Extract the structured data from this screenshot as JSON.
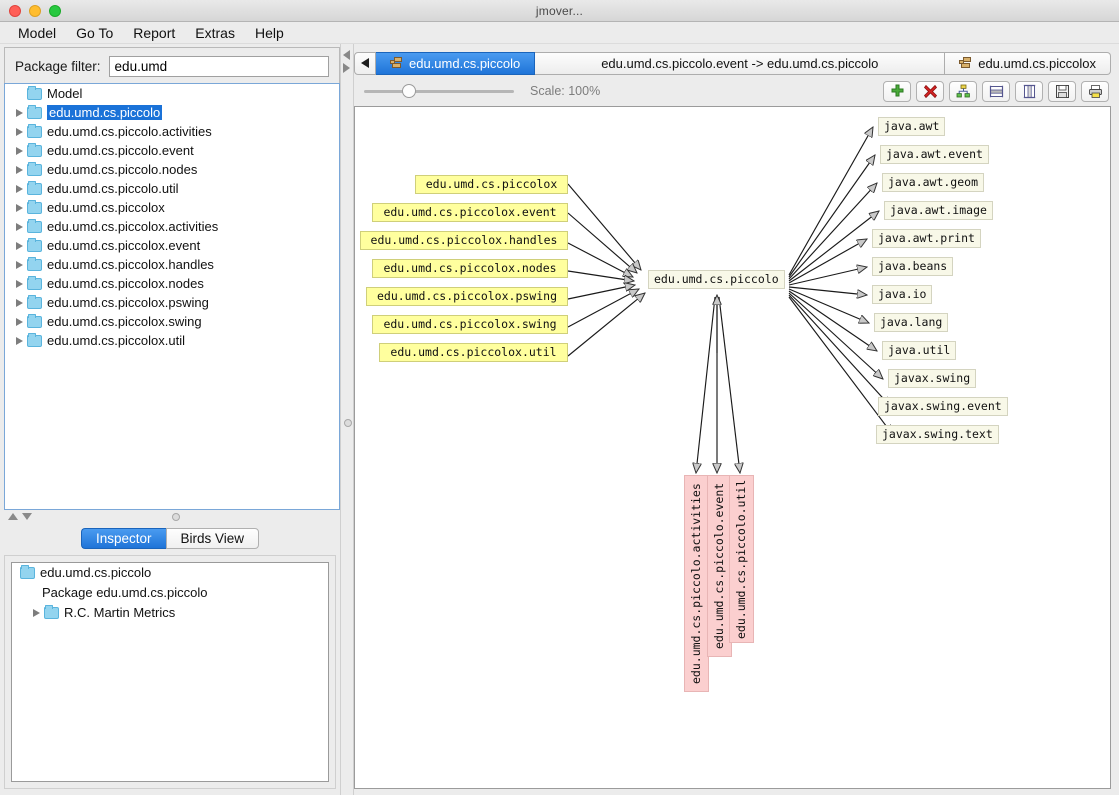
{
  "window": {
    "title": "jmover...",
    "traffic_lights": [
      "close-red",
      "minimize-yellow",
      "zoom-green"
    ]
  },
  "menubar": {
    "items": [
      "Model",
      "Go To",
      "Report",
      "Extras",
      "Help"
    ]
  },
  "left_panel": {
    "filter": {
      "label": "Package filter:",
      "value": "edu.umd"
    },
    "tree": {
      "root": "Model",
      "items": [
        {
          "label": "edu.umd.cs.piccolo",
          "selected": true
        },
        {
          "label": "edu.umd.cs.piccolo.activities",
          "selected": false
        },
        {
          "label": "edu.umd.cs.piccolo.event",
          "selected": false
        },
        {
          "label": "edu.umd.cs.piccolo.nodes",
          "selected": false
        },
        {
          "label": "edu.umd.cs.piccolo.util",
          "selected": false
        },
        {
          "label": "edu.umd.cs.piccolox",
          "selected": false
        },
        {
          "label": "edu.umd.cs.piccolox.activities",
          "selected": false
        },
        {
          "label": "edu.umd.cs.piccolox.event",
          "selected": false
        },
        {
          "label": "edu.umd.cs.piccolox.handles",
          "selected": false
        },
        {
          "label": "edu.umd.cs.piccolox.nodes",
          "selected": false
        },
        {
          "label": "edu.umd.cs.piccolox.pswing",
          "selected": false
        },
        {
          "label": "edu.umd.cs.piccolox.swing",
          "selected": false
        },
        {
          "label": "edu.umd.cs.piccolox.util",
          "selected": false
        }
      ]
    },
    "bottom_tabs": [
      {
        "label": "Inspector",
        "active": true
      },
      {
        "label": "Birds View",
        "active": false
      }
    ],
    "inspector": {
      "rows": [
        "edu.umd.cs.piccolo",
        "Package edu.umd.cs.piccolo",
        "R.C. Martin Metrics"
      ]
    }
  },
  "right_panel": {
    "tabs": [
      {
        "label": "edu.umd.cs.piccolo",
        "active": true,
        "icon": "package-icon"
      },
      {
        "label": "edu.umd.cs.piccolo.event -> edu.umd.cs.piccolo",
        "active": false,
        "icon": "none"
      },
      {
        "label": "edu.umd.cs.piccolox",
        "active": false,
        "icon": "package-icon"
      }
    ],
    "back_button": "back-arrow-icon",
    "toolbar": {
      "scale_label": "Scale: 100%",
      "scale_value": 100,
      "buttons": [
        {
          "name": "add-button",
          "icon": "plus-icon"
        },
        {
          "name": "delete-button",
          "icon": "red-x-icon"
        },
        {
          "name": "hierarchy-layout-button",
          "icon": "hierarchy-icon"
        },
        {
          "name": "horizontal-layout-button",
          "icon": "horizontal-layout-icon"
        },
        {
          "name": "vertical-layout-button",
          "icon": "vertical-layout-icon"
        },
        {
          "name": "save-button",
          "icon": "floppy-disk-icon"
        },
        {
          "name": "print-button",
          "icon": "printer-icon"
        }
      ]
    }
  },
  "diagram": {
    "center_node": {
      "label": "edu.umd.cs.piccolo",
      "color": "#f8f8e8"
    },
    "incoming_nodes": [
      {
        "label": "edu.umd.cs.piccolox",
        "color": "#ffff9e"
      },
      {
        "label": "edu.umd.cs.piccolox.event",
        "color": "#ffff9e"
      },
      {
        "label": "edu.umd.cs.piccolox.handles",
        "color": "#ffff9e"
      },
      {
        "label": "edu.umd.cs.piccolox.nodes",
        "color": "#ffff9e"
      },
      {
        "label": "edu.umd.cs.piccolox.pswing",
        "color": "#ffff9e"
      },
      {
        "label": "edu.umd.cs.piccolox.swing",
        "color": "#ffff9e"
      },
      {
        "label": "edu.umd.cs.piccolox.util",
        "color": "#ffff9e"
      }
    ],
    "outgoing_nodes": [
      {
        "label": "java.awt",
        "color": "#f8f8e8"
      },
      {
        "label": "java.awt.event",
        "color": "#f8f8e8"
      },
      {
        "label": "java.awt.geom",
        "color": "#f8f8e8"
      },
      {
        "label": "java.awt.image",
        "color": "#f8f8e8"
      },
      {
        "label": "java.awt.print",
        "color": "#f8f8e8"
      },
      {
        "label": "java.beans",
        "color": "#f8f8e8"
      },
      {
        "label": "java.io",
        "color": "#f8f8e8"
      },
      {
        "label": "java.lang",
        "color": "#f8f8e8"
      },
      {
        "label": "java.util",
        "color": "#f8f8e8"
      },
      {
        "label": "javax.swing",
        "color": "#f8f8e8"
      },
      {
        "label": "javax.swing.event",
        "color": "#f8f8e8"
      },
      {
        "label": "javax.swing.text",
        "color": "#f8f8e8"
      }
    ],
    "bottom_nodes": [
      {
        "label": "edu.umd.cs.piccolo.activities",
        "color": "#fbcfcf"
      },
      {
        "label": "edu.umd.cs.piccolo.event",
        "color": "#fbcfcf"
      },
      {
        "label": "edu.umd.cs.piccolo.util",
        "color": "#fbcfcf"
      }
    ]
  }
}
